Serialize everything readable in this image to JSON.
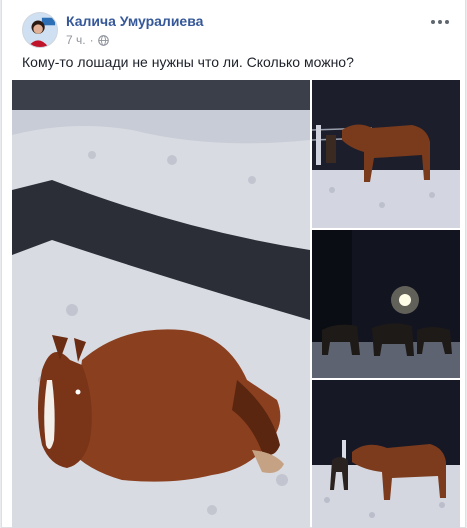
{
  "post": {
    "author": "Калича Умуралиева",
    "time": "7 ч.",
    "meta_separator": "·",
    "text": "Кому-то лошади не нужны что ли. Сколько можно?",
    "privacy_icon": "globe-icon",
    "menu_icon": "more-options-icon"
  },
  "photos": [
    {
      "icon": "photo-horse-lying-snow"
    },
    {
      "icon": "photo-horse-night-fence"
    },
    {
      "icon": "photo-horses-streetlight"
    },
    {
      "icon": "photo-horse-standing-snow"
    }
  ],
  "colors": {
    "author_link": "#365899",
    "meta_gray": "#90949c",
    "text": "#1d2129",
    "snow": "#e8e8ec",
    "horse": "#8a3f1f"
  }
}
